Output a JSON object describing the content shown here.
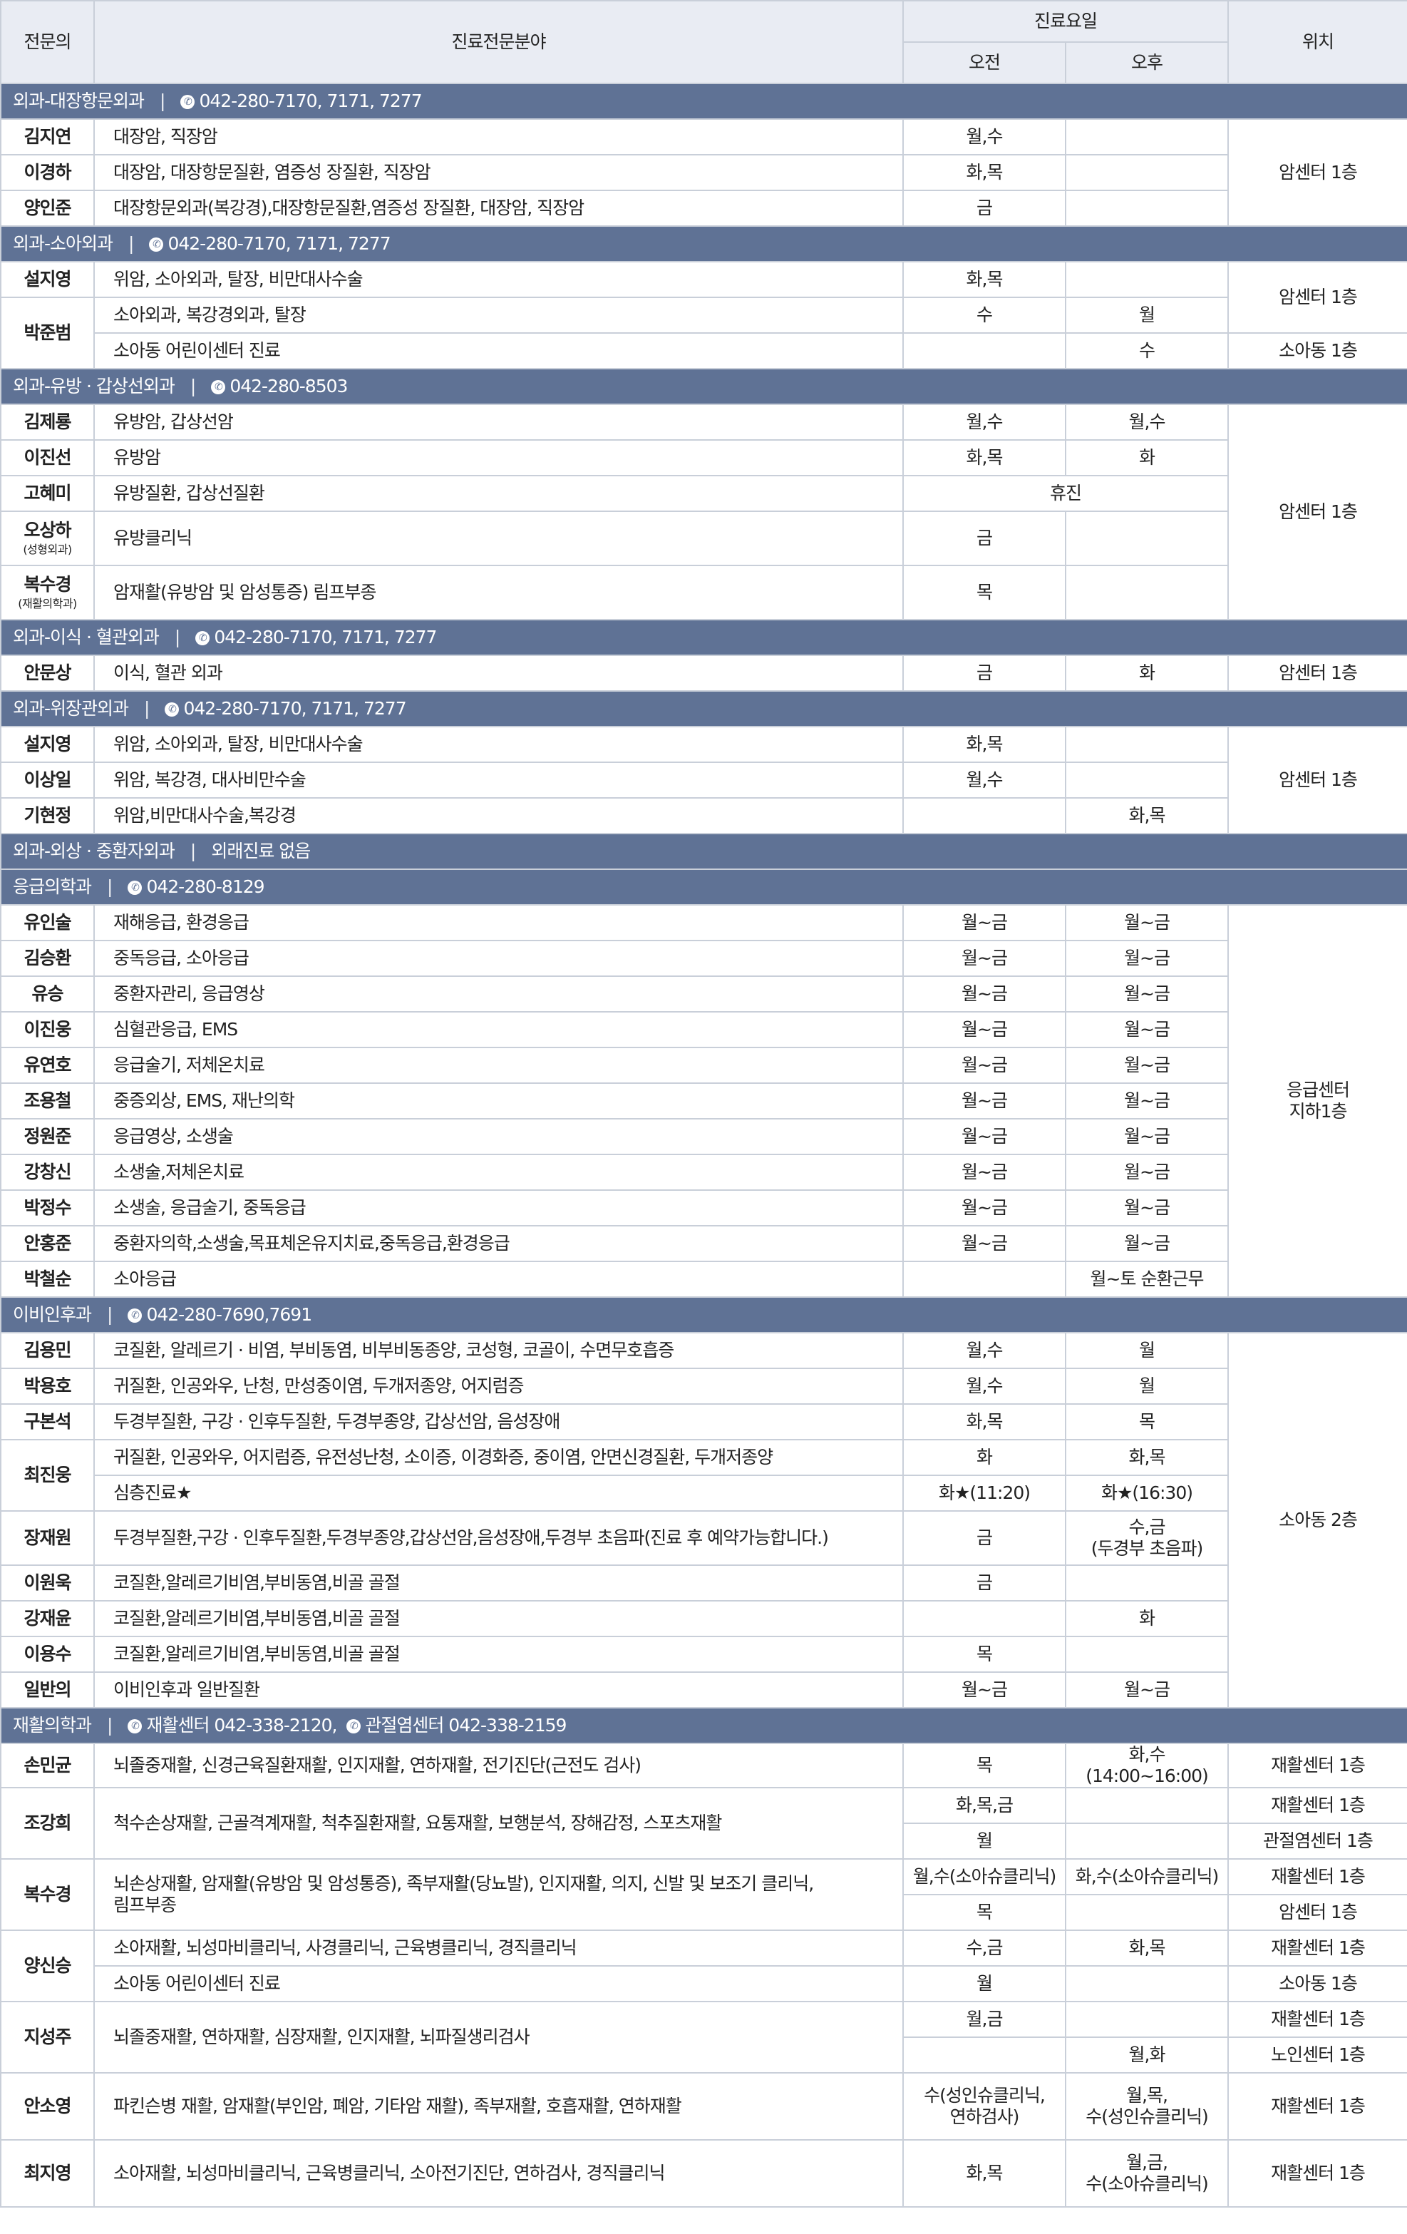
{
  "header": {
    "doctor": "전문의",
    "specialty": "진료전문분야",
    "days": "진료요일",
    "am": "오전",
    "pm": "오후",
    "location": "위치"
  },
  "sections": [
    {
      "dept": "외과-대장항문외과",
      "contact": "042-280-7170, 7171, 7277",
      "rows": [
        {
          "name": "김지연",
          "spec": "대장암, 직장암",
          "am": "월,수",
          "pm": "",
          "loc": "암센터 1층"
        },
        {
          "name": "이경하",
          "spec": "대장암, 대장항문질환, 염증성 장질환, 직장암",
          "am": "화,목",
          "pm": ""
        },
        {
          "name": "양인준",
          "spec": "대장항문외과(복강경),대장항문질환,염증성 장질환, 대장암, 직장암",
          "am": "금",
          "pm": ""
        }
      ]
    },
    {
      "dept": "외과-소아외과",
      "contact": "042-280-7170, 7171, 7277",
      "rows": [
        {
          "name": "설지영",
          "spec": "위암, 소아외과, 탈장, 비만대사수술",
          "am": "화,목",
          "pm": "",
          "loc": "암센터 1층"
        },
        {
          "name": "박준범",
          "spec": "소아외과, 복강경외과, 탈장",
          "am": "수",
          "pm": "월"
        },
        {
          "spec": "소아동 어린이센터 진료",
          "am": "",
          "pm": "수",
          "loc": "소아동 1층"
        }
      ]
    },
    {
      "dept": "외과-유방 · 갑상선외과",
      "contact": "042-280-8503",
      "rows": [
        {
          "name": "김제룡",
          "spec": "유방암, 갑상선암",
          "am": "월,수",
          "pm": "월,수",
          "loc": "암센터 1층"
        },
        {
          "name": "이진선",
          "spec": "유방암",
          "am": "화,목",
          "pm": "화"
        },
        {
          "name": "고혜미",
          "spec": "유방질환, 갑상선질환",
          "both": "휴진"
        },
        {
          "name": "오상하",
          "sub": "(성형외과)",
          "spec": "유방클리닉",
          "am": "금",
          "pm": ""
        },
        {
          "name": "복수경",
          "sub": "(재활의학과)",
          "spec": "암재활(유방암 및 암성통증) 림프부종",
          "am": "목",
          "pm": ""
        }
      ]
    },
    {
      "dept": "외과-이식 · 혈관외과",
      "contact": "042-280-7170, 7171, 7277",
      "rows": [
        {
          "name": "안문상",
          "spec": "이식, 혈관 외과",
          "am": "금",
          "pm": "화",
          "loc": "암센터 1층"
        }
      ]
    },
    {
      "dept": "외과-위장관외과",
      "contact": "042-280-7170, 7171, 7277",
      "rows": [
        {
          "name": "설지영",
          "spec": "위암, 소아외과, 탈장, 비만대사수술",
          "am": "화,목",
          "pm": "",
          "loc": "암센터 1층"
        },
        {
          "name": "이상일",
          "spec": "위암, 복강경, 대사비만수술",
          "am": "월,수",
          "pm": ""
        },
        {
          "name": "기현정",
          "spec": "위암,비만대사수술,복강경",
          "am": "",
          "pm": "화,목"
        }
      ]
    },
    {
      "dept": "외과-외상 · 중환자외과",
      "contact": "외래진료 없음",
      "noIcon": true,
      "rows": []
    },
    {
      "dept": "응급의학과",
      "contact": "042-280-8129",
      "rows": [
        {
          "name": "유인술",
          "spec": "재해응급, 환경응급",
          "am": "월~금",
          "pm": "월~금",
          "loc": "응급센터\n지하1층"
        },
        {
          "name": "김승환",
          "spec": "중독응급, 소아응급",
          "am": "월~금",
          "pm": "월~금"
        },
        {
          "name": "유승",
          "spec": "중환자관리, 응급영상",
          "am": "월~금",
          "pm": "월~금"
        },
        {
          "name": "이진웅",
          "spec": "심혈관응급, EMS",
          "am": "월~금",
          "pm": "월~금"
        },
        {
          "name": "유연호",
          "spec": "응급술기, 저체온치료",
          "am": "월~금",
          "pm": "월~금"
        },
        {
          "name": "조용철",
          "spec": "중증외상, EMS, 재난의학",
          "am": "월~금",
          "pm": "월~금"
        },
        {
          "name": "정원준",
          "spec": "응급영상, 소생술",
          "am": "월~금",
          "pm": "월~금"
        },
        {
          "name": "강창신",
          "spec": "소생술,저체온치료",
          "am": "월~금",
          "pm": "월~금"
        },
        {
          "name": "박정수",
          "spec": "소생술, 응급술기, 중독응급",
          "am": "월~금",
          "pm": "월~금"
        },
        {
          "name": "안홍준",
          "spec": "중환자의학,소생술,목표체온유지치료,중독응급,환경응급",
          "am": "월~금",
          "pm": "월~금"
        },
        {
          "name": "박철순",
          "spec": "소아응급",
          "am": "",
          "pm": "월~토 순환근무"
        }
      ]
    },
    {
      "dept": "이비인후과",
      "contact": "042-280-7690,7691",
      "rows": [
        {
          "name": "김용민",
          "spec": "코질환, 알레르기 · 비염, 부비동염, 비부비동종양, 코성형, 코골이, 수면무호흡증",
          "am": "월,수",
          "pm": "월",
          "loc": "소아동 2층"
        },
        {
          "name": "박용호",
          "spec": "귀질환, 인공와우, 난청, 만성중이염, 두개저종양, 어지럼증",
          "am": "월,수",
          "pm": "월"
        },
        {
          "name": "구본석",
          "spec": "두경부질환, 구강 · 인후두질환, 두경부종양, 갑상선암, 음성장애",
          "am": "화,목",
          "pm": "목"
        },
        {
          "name": "최진웅",
          "spec": "귀질환, 인공와우, 어지럼증, 유전성난청, 소이증, 이경화증, 중이염, 안면신경질환, 두개저종양",
          "am": "화",
          "pm": "화,목"
        },
        {
          "spec": "심층진료★",
          "am": "화★(11:20)",
          "pm": "화★(16:30)"
        },
        {
          "name": "장재원",
          "spec": "두경부질환,구강 · 인후두질환,두경부종양,갑상선암,음성장애,두경부 초음파(진료 후 예약가능합니다.)",
          "am": "금",
          "pm": "수,금\n(두경부 초음파)"
        },
        {
          "name": "이원욱",
          "spec": "코질환,알레르기비염,부비동염,비골 골절",
          "am": "금",
          "pm": ""
        },
        {
          "name": "강재윤",
          "spec": "코질환,알레르기비염,부비동염,비골 골절",
          "am": "",
          "pm": "화"
        },
        {
          "name": "이용수",
          "spec": "코질환,알레르기비염,부비동염,비골 골절",
          "am": "목",
          "pm": ""
        },
        {
          "name": "일반의",
          "spec": "이비인후과 일반질환",
          "am": "월~금",
          "pm": "월~금"
        }
      ]
    },
    {
      "dept": "재활의학과",
      "contact": "재활센터 042-338-2120,",
      "contact2": "관절염센터 042-338-2159",
      "rows": [
        {
          "name": "손민균",
          "spec": "뇌졸중재활, 신경근육질환재활, 인지재활, 연하재활, 전기진단(근전도 검사)",
          "am": "목",
          "pm": "화,수(14:00~16:00)",
          "loc": "재활센터 1층"
        },
        {
          "name": "조강희",
          "spec": "척수손상재활, 근골격계재활, 척추질환재활, 요통재활, 보행분석, 장해감정, 스포츠재활",
          "am": "화,목,금",
          "pm": "",
          "loc": "재활센터 1층"
        },
        {
          "am": "월",
          "pm": "",
          "loc": "관절염센터 1층"
        },
        {
          "name": "복수경",
          "spec": "뇌손상재활, 암재활(유방암 및 암성통증), 족부재활(당뇨발), 인지재활, 의지, 신발 및 보조기 클리닉,\n림프부종",
          "am": "월,수(소아슈클리닉)",
          "pm": "화,수(소아슈클리닉)",
          "loc": "재활센터 1층"
        },
        {
          "am": "목",
          "pm": "",
          "loc": "암센터 1층"
        },
        {
          "name": "양신승",
          "spec": "소아재활, 뇌성마비클리닉, 사경클리닉, 근육병클리닉, 경직클리닉",
          "am": "수,금",
          "pm": "화,목",
          "loc": "재활센터 1층"
        },
        {
          "spec": "소아동 어린이센터 진료",
          "am": "월",
          "pm": "",
          "loc": "소아동 1층"
        },
        {
          "name": "지성주",
          "spec": "뇌졸중재활, 연하재활, 심장재활, 인지재활, 뇌파질생리검사",
          "am": "월,금",
          "pm": "",
          "loc": "재활센터 1층"
        },
        {
          "am": "",
          "pm": "월,화",
          "loc": "노인센터 1층"
        },
        {
          "name": "안소영",
          "spec": "파킨슨병 재활, 암재활(부인암, 폐암, 기타암 재활), 족부재활, 호흡재활, 연하재활",
          "am": "수(성인슈클리닉,\n연하검사)",
          "pm": "월,목,\n수(성인슈클리닉)",
          "loc": "재활센터 1층"
        },
        {
          "name": "최지영",
          "spec": "소아재활, 뇌성마비클리닉, 근육병클리닉, 소아전기진단, 연하검사, 경직클리닉",
          "am": "화,목",
          "pm": "월,금,\n수(소아슈클리닉)",
          "loc": "재활센터 1층"
        }
      ]
    }
  ]
}
